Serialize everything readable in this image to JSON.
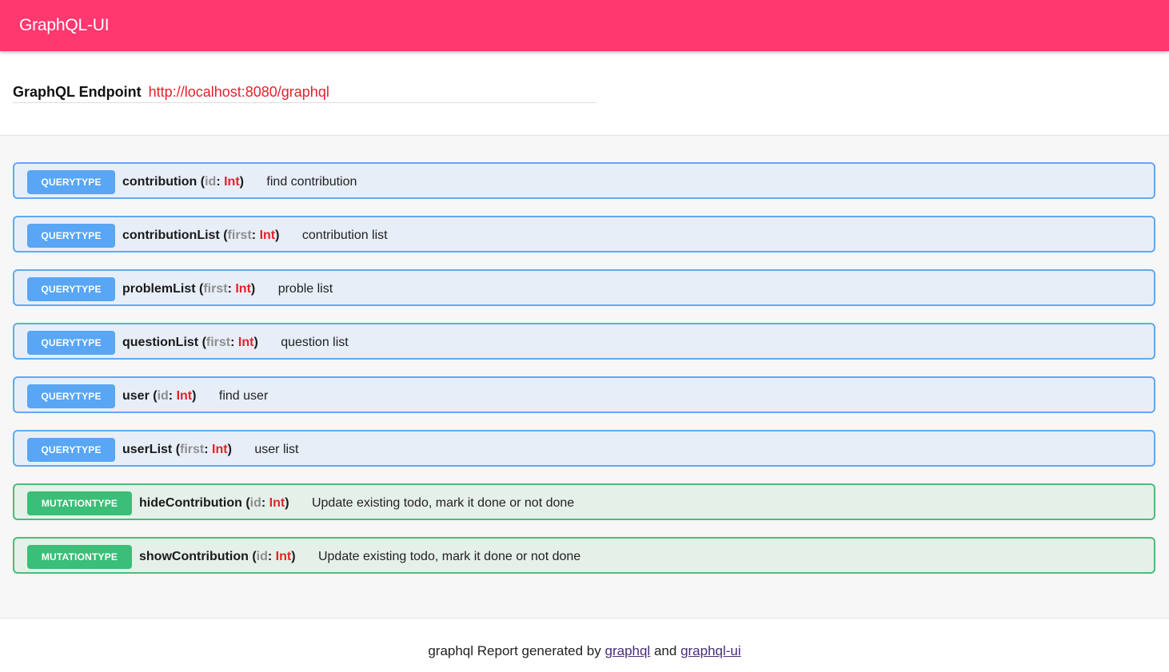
{
  "header": {
    "title": "GraphQL-UI"
  },
  "endpoint": {
    "label": "GraphQL Endpoint",
    "url": "http://localhost:8080/graphql"
  },
  "operations": [
    {
      "kind": "QUERYTYPE",
      "name": "contribution",
      "arg": "id",
      "type": "Int",
      "description": "find contribution"
    },
    {
      "kind": "QUERYTYPE",
      "name": "contributionList",
      "arg": "first",
      "type": "Int",
      "description": "contribution list"
    },
    {
      "kind": "QUERYTYPE",
      "name": "problemList",
      "arg": "first",
      "type": "Int",
      "description": "proble list"
    },
    {
      "kind": "QUERYTYPE",
      "name": "questionList",
      "arg": "first",
      "type": "Int",
      "description": "question list"
    },
    {
      "kind": "QUERYTYPE",
      "name": "user",
      "arg": "id",
      "type": "Int",
      "description": "find user"
    },
    {
      "kind": "QUERYTYPE",
      "name": "userList",
      "arg": "first",
      "type": "Int",
      "description": "user list"
    },
    {
      "kind": "MUTATIONTYPE",
      "name": "hideContribution",
      "arg": "id",
      "type": "Int",
      "description": "Update existing todo, mark it done or not done"
    },
    {
      "kind": "MUTATIONTYPE",
      "name": "showContribution",
      "arg": "id",
      "type": "Int",
      "description": "Update existing todo, mark it done or not done"
    }
  ],
  "footer": {
    "prefix": "graphql Report generated by",
    "link1": "graphql",
    "and": "and",
    "link2": "graphql-ui"
  },
  "colors": {
    "header": "#ff3870",
    "query_border": "#62a8f2",
    "query_badge": "#58a6f4",
    "mutation_border": "#48be7a",
    "mutation_badge": "#3bbe77",
    "type": "#e8202a"
  }
}
